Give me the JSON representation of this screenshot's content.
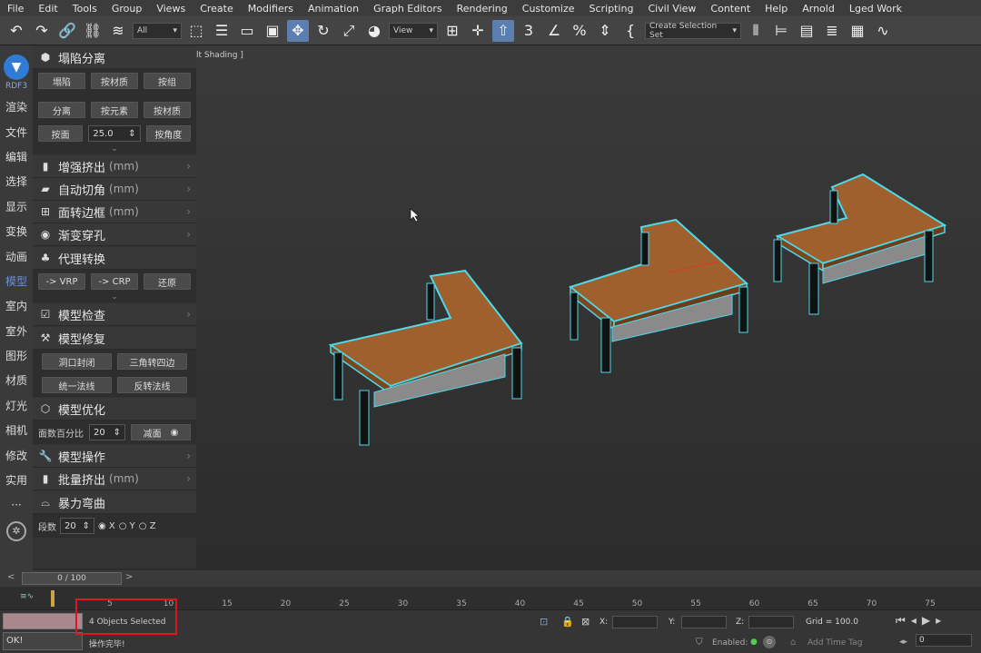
{
  "menu": [
    "File",
    "Edit",
    "Tools",
    "Group",
    "Views",
    "Create",
    "Modifiers",
    "Animation",
    "Graph Editors",
    "Rendering",
    "Customize",
    "Scripting",
    "Civil View",
    "Content",
    "Help",
    "Arnold",
    "Lged Work"
  ],
  "toolbar": {
    "filter_select": "All",
    "view_select": "View",
    "selection_set": "Create Selection Set"
  },
  "sidebar": {
    "brand": "RDF3",
    "items": [
      "渲染",
      "文件",
      "编辑",
      "选择",
      "显示",
      "变换",
      "动画",
      "模型",
      "室内",
      "室外",
      "图形",
      "材质",
      "灯光",
      "相机",
      "修改",
      "实用",
      "···"
    ],
    "selected": "模型"
  },
  "panel": {
    "collapse": {
      "title": "塌陷分离",
      "row1": [
        "塌陷",
        "按材质",
        "按组"
      ],
      "row2": [
        "分离",
        "按元素",
        "按材质"
      ],
      "row3_btn": "按面",
      "row3_value": "25.0",
      "row3_btn2": "按角度"
    },
    "enhanced_extrude": {
      "title": "增强挤出",
      "unit": "(mm)"
    },
    "auto_chamfer": {
      "title": "自动切角",
      "unit": "(mm)"
    },
    "face_border": {
      "title": "面转边框",
      "unit": "(mm)"
    },
    "gradient_hole": {
      "title": "渐变穿孔"
    },
    "proxy": {
      "title": "代理转换",
      "buttons": [
        "-> VRP",
        "-> CRP",
        "还原"
      ]
    },
    "model_check": {
      "title": "模型检查"
    },
    "model_repair": {
      "title": "模型修复",
      "buttons": [
        "洞口封闭",
        "三角转四边",
        "统一法线",
        "反转法线"
      ]
    },
    "model_optimize": {
      "title": "模型优化",
      "label": "面数百分比",
      "value": "20",
      "button": "减面"
    },
    "model_ops": {
      "title": "模型操作"
    },
    "batch_extrude": {
      "title": "批量挤出",
      "unit": "(mm)"
    },
    "violent_bend": {
      "title": "暴力弯曲",
      "label": "段数",
      "value": "20",
      "axes": [
        "X",
        "Y",
        "Z"
      ],
      "selected_axis": "X"
    }
  },
  "viewport": {
    "label": "lt Shading ]"
  },
  "timeline": {
    "frame": "0 / 100",
    "ticks": [
      "5",
      "10",
      "15",
      "20",
      "25",
      "30",
      "35",
      "40",
      "45",
      "50",
      "55",
      "60",
      "65",
      "70",
      "75"
    ]
  },
  "status": {
    "selection": "4 Objects Selected",
    "prompt": "操作完毕!",
    "ok": "OK!",
    "x_label": "X:",
    "y_label": "Y:",
    "z_label": "Z:",
    "grid": "Grid = 100.0",
    "enabled": "Enabled:",
    "add_time_tag": "Add Time Tag",
    "frame_value": "0"
  }
}
